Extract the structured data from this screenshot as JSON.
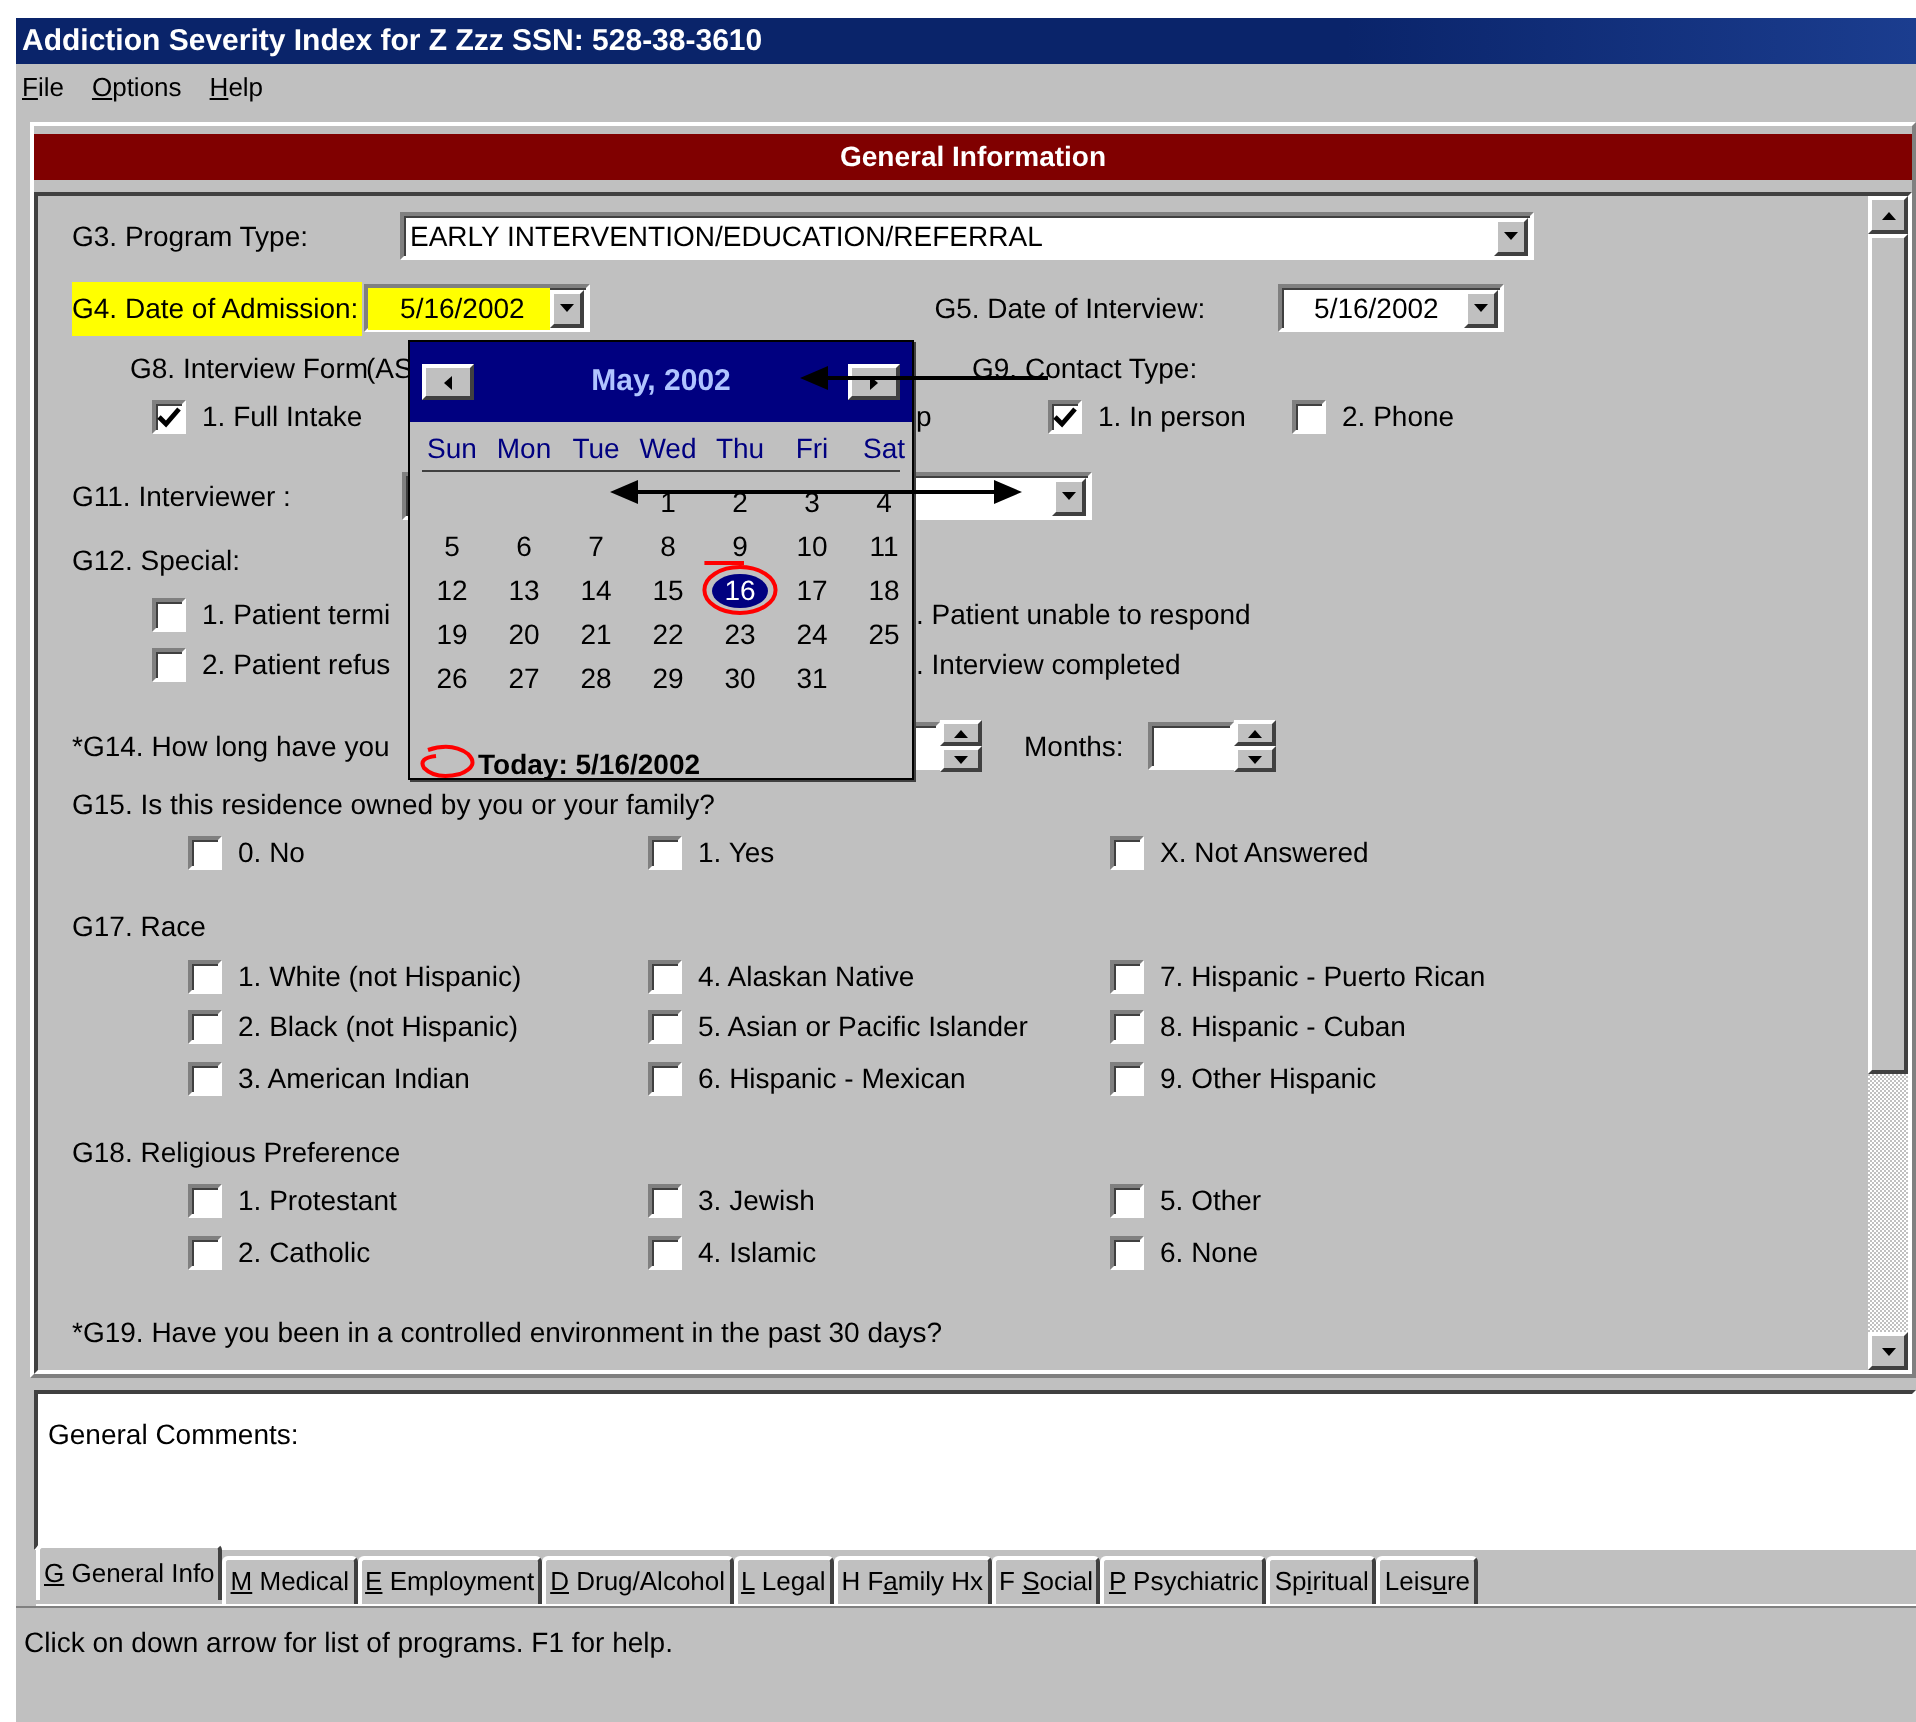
{
  "window": {
    "title": "Addiction Severity Index for  Z Zzz  SSN: 528-38-3610"
  },
  "menu": [
    {
      "mnemonic": "F",
      "rest": "ile"
    },
    {
      "mnemonic": "O",
      "rest": "ptions"
    },
    {
      "mnemonic": "H",
      "rest": "elp"
    }
  ],
  "panel_title": "General Information",
  "g3": {
    "label": "G3. Program Type:",
    "value": "EARLY INTERVENTION/EDUCATION/REFERRAL"
  },
  "g4": {
    "label": "G4. Date of Admission:",
    "value": "5/16/2002",
    "highlighted": true
  },
  "g5": {
    "label": "G5. Date of Interview:",
    "value": "5/16/2002",
    "highlighted": false
  },
  "g8": {
    "label": "G8. Interview Form",
    "note": "(AS",
    "options": [
      {
        "label": "1. Full Intake",
        "checked": true
      }
    ],
    "tail": "p"
  },
  "g9": {
    "label": "G9. Contact Type:",
    "options": [
      {
        "label": "1. In person",
        "checked": true
      },
      {
        "label": "2. Phone",
        "checked": false
      }
    ]
  },
  "g11": {
    "label": "G11. Interviewer :"
  },
  "g12": {
    "label": "G12. Special:",
    "options": [
      {
        "label": "1. Patient termi",
        "checked": false,
        "tail": ". Patient unable to respond"
      },
      {
        "label": "2. Patient refus",
        "checked": false,
        "tail": ". Interview completed"
      }
    ]
  },
  "g14": {
    "label": "*G14. How long have you",
    "months_label": "Months:"
  },
  "questions": [
    {
      "label": "G15. Is this residence owned by you or your family?",
      "rows": [
        [
          {
            "label": "0. No",
            "checked": false
          },
          {
            "label": "1. Yes",
            "checked": false
          },
          {
            "label": "X. Not Answered",
            "checked": false
          }
        ]
      ]
    },
    {
      "label": "G17. Race",
      "rows": [
        [
          {
            "label": "1. White (not Hispanic)",
            "checked": false
          },
          {
            "label": "4. Alaskan Native",
            "checked": false
          },
          {
            "label": "7. Hispanic - Puerto Rican",
            "checked": false
          }
        ],
        [
          {
            "label": "2. Black (not Hispanic)",
            "checked": false
          },
          {
            "label": "5. Asian or Pacific Islander",
            "checked": false
          },
          {
            "label": "8. Hispanic - Cuban",
            "checked": false
          }
        ],
        [
          {
            "label": "3. American Indian",
            "checked": false
          },
          {
            "label": "6. Hispanic - Mexican",
            "checked": false
          },
          {
            "label": "9. Other Hispanic",
            "checked": false
          }
        ]
      ]
    },
    {
      "label": "G18. Religious Preference",
      "rows": [
        [
          {
            "label": "1. Protestant",
            "checked": false
          },
          {
            "label": "3. Jewish",
            "checked": false
          },
          {
            "label": "5. Other",
            "checked": false
          }
        ],
        [
          {
            "label": "2. Catholic",
            "checked": false
          },
          {
            "label": "4. Islamic",
            "checked": false
          },
          {
            "label": "6. None",
            "checked": false
          }
        ]
      ]
    },
    {
      "label": "*G19. Have you been in a controlled environment in the past 30 days?"
    }
  ],
  "calendar": {
    "month": "May, 2002",
    "weekdays": [
      "Sun",
      "Mon",
      "Tue",
      "Wed",
      "Thu",
      "Fri",
      "Sat"
    ],
    "weeks": [
      [
        {
          "day": "1",
          "selected": false
        },
        {
          "day": "2",
          "selected": false
        },
        {
          "day": "3",
          "selected": false
        },
        {
          "day": "4",
          "selected": false
        }
      ],
      [
        {
          "day": "5",
          "selected": false
        },
        {
          "day": "6",
          "selected": false
        },
        {
          "day": "7",
          "selected": false
        },
        {
          "day": "8",
          "selected": false
        },
        {
          "day": "9",
          "selected": false
        },
        {
          "day": "10",
          "selected": false
        },
        {
          "day": "11",
          "selected": false
        }
      ],
      [
        {
          "day": "12",
          "selected": false
        },
        {
          "day": "13",
          "selected": false
        },
        {
          "day": "14",
          "selected": false
        },
        {
          "day": "15",
          "selected": false
        },
        {
          "day": "16",
          "selected": true
        },
        {
          "day": "17",
          "selected": false
        },
        {
          "day": "18",
          "selected": false
        }
      ],
      [
        {
          "day": "19",
          "selected": false
        },
        {
          "day": "20",
          "selected": false
        },
        {
          "day": "21",
          "selected": false
        },
        {
          "day": "22",
          "selected": false
        },
        {
          "day": "23",
          "selected": false
        },
        {
          "day": "24",
          "selected": false
        },
        {
          "day": "25",
          "selected": false
        }
      ],
      [
        {
          "day": "26",
          "selected": false
        },
        {
          "day": "27",
          "selected": false
        },
        {
          "day": "28",
          "selected": false
        },
        {
          "day": "29",
          "selected": false
        },
        {
          "day": "30",
          "selected": false
        },
        {
          "day": "31",
          "selected": false
        }
      ]
    ],
    "today_label": "Today: 5/16/2002"
  },
  "comments": {
    "label": "General Comments:"
  },
  "tabs": [
    {
      "mnemonic": "G",
      "after": " General Info",
      "selected": true
    },
    {
      "mnemonic": "M",
      "after": " Medical",
      "selected": false
    },
    {
      "mnemonic": "E",
      "after": " Employment",
      "selected": false
    },
    {
      "mnemonic": "D",
      "after": " Drug/Alcohol",
      "selected": false
    },
    {
      "mnemonic": "L",
      "after": " Legal",
      "selected": false
    },
    {
      "before": "H F",
      "mnemonic": "a",
      "after": "mily Hx",
      "selected": false
    },
    {
      "before": "F ",
      "mnemonic": "S",
      "after": "ocial",
      "selected": false
    },
    {
      "mnemonic": "P",
      "after": " Psychiatric",
      "selected": false
    },
    {
      "before": "Sp",
      "mnemonic": "i",
      "after": "ritual",
      "selected": false
    },
    {
      "before": "Leis",
      "mnemonic": "u",
      "after": "re",
      "selected": false
    }
  ],
  "status_bar": "Click on down arrow for list of programs. F1 for help."
}
